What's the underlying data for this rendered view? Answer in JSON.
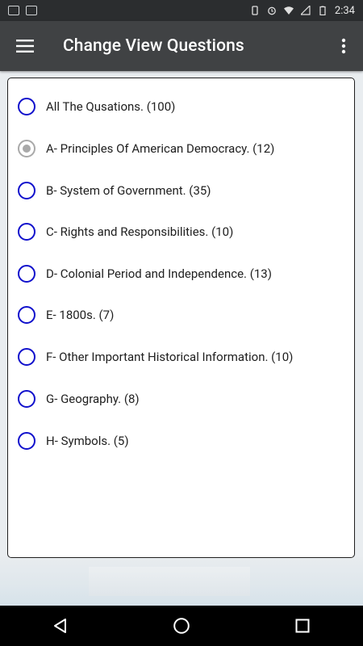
{
  "status_bar": {
    "time": "2:34",
    "left_icons": [
      "image-icon",
      "photo-icon"
    ],
    "right_icons": [
      "vibrate-icon",
      "alarm-icon",
      "wifi-icon",
      "signal-icon",
      "battery-icon"
    ]
  },
  "app_bar": {
    "title": "Change View Questions",
    "menu_icon": "hamburger-menu-icon",
    "overflow_icon": "more-vert-icon"
  },
  "options": [
    {
      "label": "All The Qusations. (100)",
      "checked": false
    },
    {
      "label": "A- Principles Of American Democracy. (12)",
      "checked": true
    },
    {
      "label": "B- System of Government. (35)",
      "checked": false
    },
    {
      "label": "C- Rights and Responsibilities. (10)",
      "checked": false
    },
    {
      "label": "D- Colonial Period and Independence. (13)",
      "checked": false
    },
    {
      "label": "E- 1800s. (7)",
      "checked": false
    },
    {
      "label": "F- Other Important Historical Information. (10)",
      "checked": false
    },
    {
      "label": "G- Geography. (8)",
      "checked": false
    },
    {
      "label": "H- Symbols. (5)",
      "checked": false
    }
  ],
  "nav_bar": {
    "back_icon": "back-triangle-icon",
    "home_icon": "home-circle-icon",
    "recents_icon": "recents-square-icon"
  },
  "colors": {
    "app_bar": "#404244",
    "status_bar": "#2b2d2f",
    "radio_unchecked": "#1010cc",
    "radio_checked": "#a9a9a9"
  }
}
